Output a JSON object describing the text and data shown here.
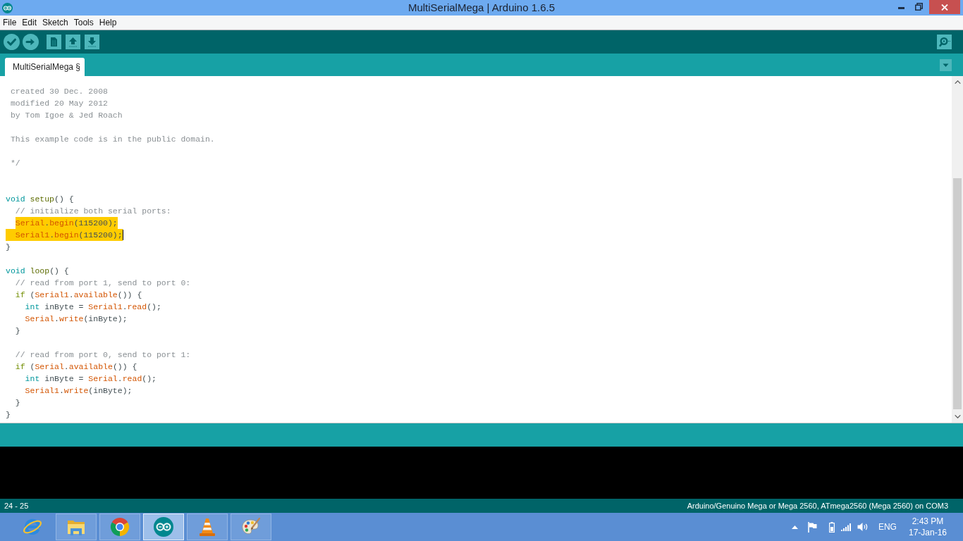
{
  "window": {
    "title": "MultiSerialMega | Arduino 1.6.5"
  },
  "menu": [
    "File",
    "Edit",
    "Sketch",
    "Tools",
    "Help"
  ],
  "tabs": [
    {
      "label": "MultiSerialMega §",
      "selected": true
    }
  ],
  "editor": {
    "lines": [
      {
        "selected": false,
        "caret": false,
        "tokens": [
          {
            "kind": "comment",
            "text": " created 30 Dec. 2008"
          }
        ]
      },
      {
        "selected": false,
        "caret": false,
        "tokens": [
          {
            "kind": "comment",
            "text": " modified 20 May 2012"
          }
        ]
      },
      {
        "selected": false,
        "caret": false,
        "tokens": [
          {
            "kind": "comment",
            "text": " by Tom Igoe & Jed Roach"
          }
        ]
      },
      {
        "selected": false,
        "caret": false
      },
      {
        "selected": false,
        "caret": false,
        "tokens": [
          {
            "kind": "comment",
            "text": " This example code is in the public domain."
          }
        ]
      },
      {
        "selected": false,
        "caret": false
      },
      {
        "selected": false,
        "caret": false,
        "tokens": [
          {
            "kind": "comment",
            "text": " */"
          }
        ]
      },
      {
        "selected": false,
        "caret": false
      },
      {
        "selected": false,
        "caret": false
      },
      {
        "selected": false,
        "caret": false,
        "tokens": [
          {
            "kind": "type",
            "text": "void"
          },
          {
            "kind": "structure",
            "text": " setup"
          },
          {
            "kind": "plain",
            "text": "() {"
          }
        ]
      },
      {
        "selected": false,
        "caret": false,
        "tokens": [
          {
            "kind": "comment",
            "text": "  // initialize both serial ports:"
          }
        ]
      },
      {
        "selected": true,
        "caret": false,
        "tokens": [
          {
            "kind": "function",
            "text": "  Serial"
          },
          {
            "kind": "plain",
            "text": "."
          },
          {
            "kind": "function",
            "text": "begin"
          },
          {
            "kind": "plain",
            "text": "(115200);"
          }
        ]
      },
      {
        "selected": true,
        "caret": true,
        "tokens": [
          {
            "kind": "function",
            "text": "  Serial1"
          },
          {
            "kind": "plain",
            "text": "."
          },
          {
            "kind": "function",
            "text": "begin"
          },
          {
            "kind": "plain",
            "text": "(115200);"
          }
        ]
      },
      {
        "selected": false,
        "caret": false,
        "tokens": [
          {
            "kind": "plain",
            "text": "}"
          }
        ]
      },
      {
        "selected": false,
        "caret": false
      },
      {
        "selected": false,
        "caret": false,
        "tokens": [
          {
            "kind": "type",
            "text": "void"
          },
          {
            "kind": "structure",
            "text": " loop"
          },
          {
            "kind": "plain",
            "text": "() {"
          }
        ]
      },
      {
        "selected": false,
        "caret": false,
        "tokens": [
          {
            "kind": "comment",
            "text": "  // read from port 1, send to port 0:"
          }
        ]
      },
      {
        "selected": false,
        "caret": false,
        "tokens": [
          {
            "kind": "keyword",
            "text": "  if"
          },
          {
            "kind": "plain",
            "text": " ("
          },
          {
            "kind": "function",
            "text": "Serial1"
          },
          {
            "kind": "plain",
            "text": "."
          },
          {
            "kind": "function",
            "text": "available"
          },
          {
            "kind": "plain",
            "text": "()) {"
          }
        ]
      },
      {
        "selected": false,
        "caret": false,
        "tokens": [
          {
            "kind": "type",
            "text": "    int"
          },
          {
            "kind": "plain",
            "text": " inByte = "
          },
          {
            "kind": "function",
            "text": "Serial1"
          },
          {
            "kind": "plain",
            "text": "."
          },
          {
            "kind": "function",
            "text": "read"
          },
          {
            "kind": "plain",
            "text": "();"
          }
        ]
      },
      {
        "selected": false,
        "caret": false,
        "tokens": [
          {
            "kind": "function",
            "text": "    Serial"
          },
          {
            "kind": "plain",
            "text": "."
          },
          {
            "kind": "function",
            "text": "write"
          },
          {
            "kind": "plain",
            "text": "(inByte);"
          }
        ]
      },
      {
        "selected": false,
        "caret": false,
        "tokens": [
          {
            "kind": "plain",
            "text": "  }"
          }
        ]
      },
      {
        "selected": false,
        "caret": false
      },
      {
        "selected": false,
        "caret": false,
        "tokens": [
          {
            "kind": "comment",
            "text": "  // read from port 0, send to port 1:"
          }
        ]
      },
      {
        "selected": false,
        "caret": false,
        "tokens": [
          {
            "kind": "keyword",
            "text": "  if"
          },
          {
            "kind": "plain",
            "text": " ("
          },
          {
            "kind": "function",
            "text": "Serial"
          },
          {
            "kind": "plain",
            "text": "."
          },
          {
            "kind": "function",
            "text": "available"
          },
          {
            "kind": "plain",
            "text": "()) {"
          }
        ]
      },
      {
        "selected": false,
        "caret": false,
        "tokens": [
          {
            "kind": "type",
            "text": "    int"
          },
          {
            "kind": "plain",
            "text": " inByte = "
          },
          {
            "kind": "function",
            "text": "Serial"
          },
          {
            "kind": "plain",
            "text": "."
          },
          {
            "kind": "function",
            "text": "read"
          },
          {
            "kind": "plain",
            "text": "();"
          }
        ]
      },
      {
        "selected": false,
        "caret": false,
        "tokens": [
          {
            "kind": "function",
            "text": "    Serial1"
          },
          {
            "kind": "plain",
            "text": "."
          },
          {
            "kind": "function",
            "text": "write"
          },
          {
            "kind": "plain",
            "text": "(inByte);"
          }
        ]
      },
      {
        "selected": false,
        "caret": false,
        "tokens": [
          {
            "kind": "plain",
            "text": "  }"
          }
        ]
      },
      {
        "selected": false,
        "caret": false,
        "tokens": [
          {
            "kind": "plain",
            "text": "}"
          }
        ]
      }
    ]
  },
  "status_bar": {
    "line_range": "24 - 25",
    "board": "Arduino/Genuino Mega or Mega 2560, ATmega2560 (Mega 2560) on COM3"
  },
  "taskbar": {
    "apps": [
      {
        "kind": "ebrowser",
        "running": false,
        "selected": false
      },
      {
        "kind": "folder",
        "running": true,
        "selected": false
      },
      {
        "kind": "wheel",
        "running": true,
        "selected": false
      },
      {
        "kind": "infinity",
        "running": true,
        "selected": true
      },
      {
        "kind": "cone",
        "running": true,
        "selected": false
      },
      {
        "kind": "palette",
        "running": true,
        "selected": false
      }
    ],
    "tray": {
      "language": "ENG",
      "time": "2:43 PM",
      "date": "17-Jan-16"
    }
  }
}
